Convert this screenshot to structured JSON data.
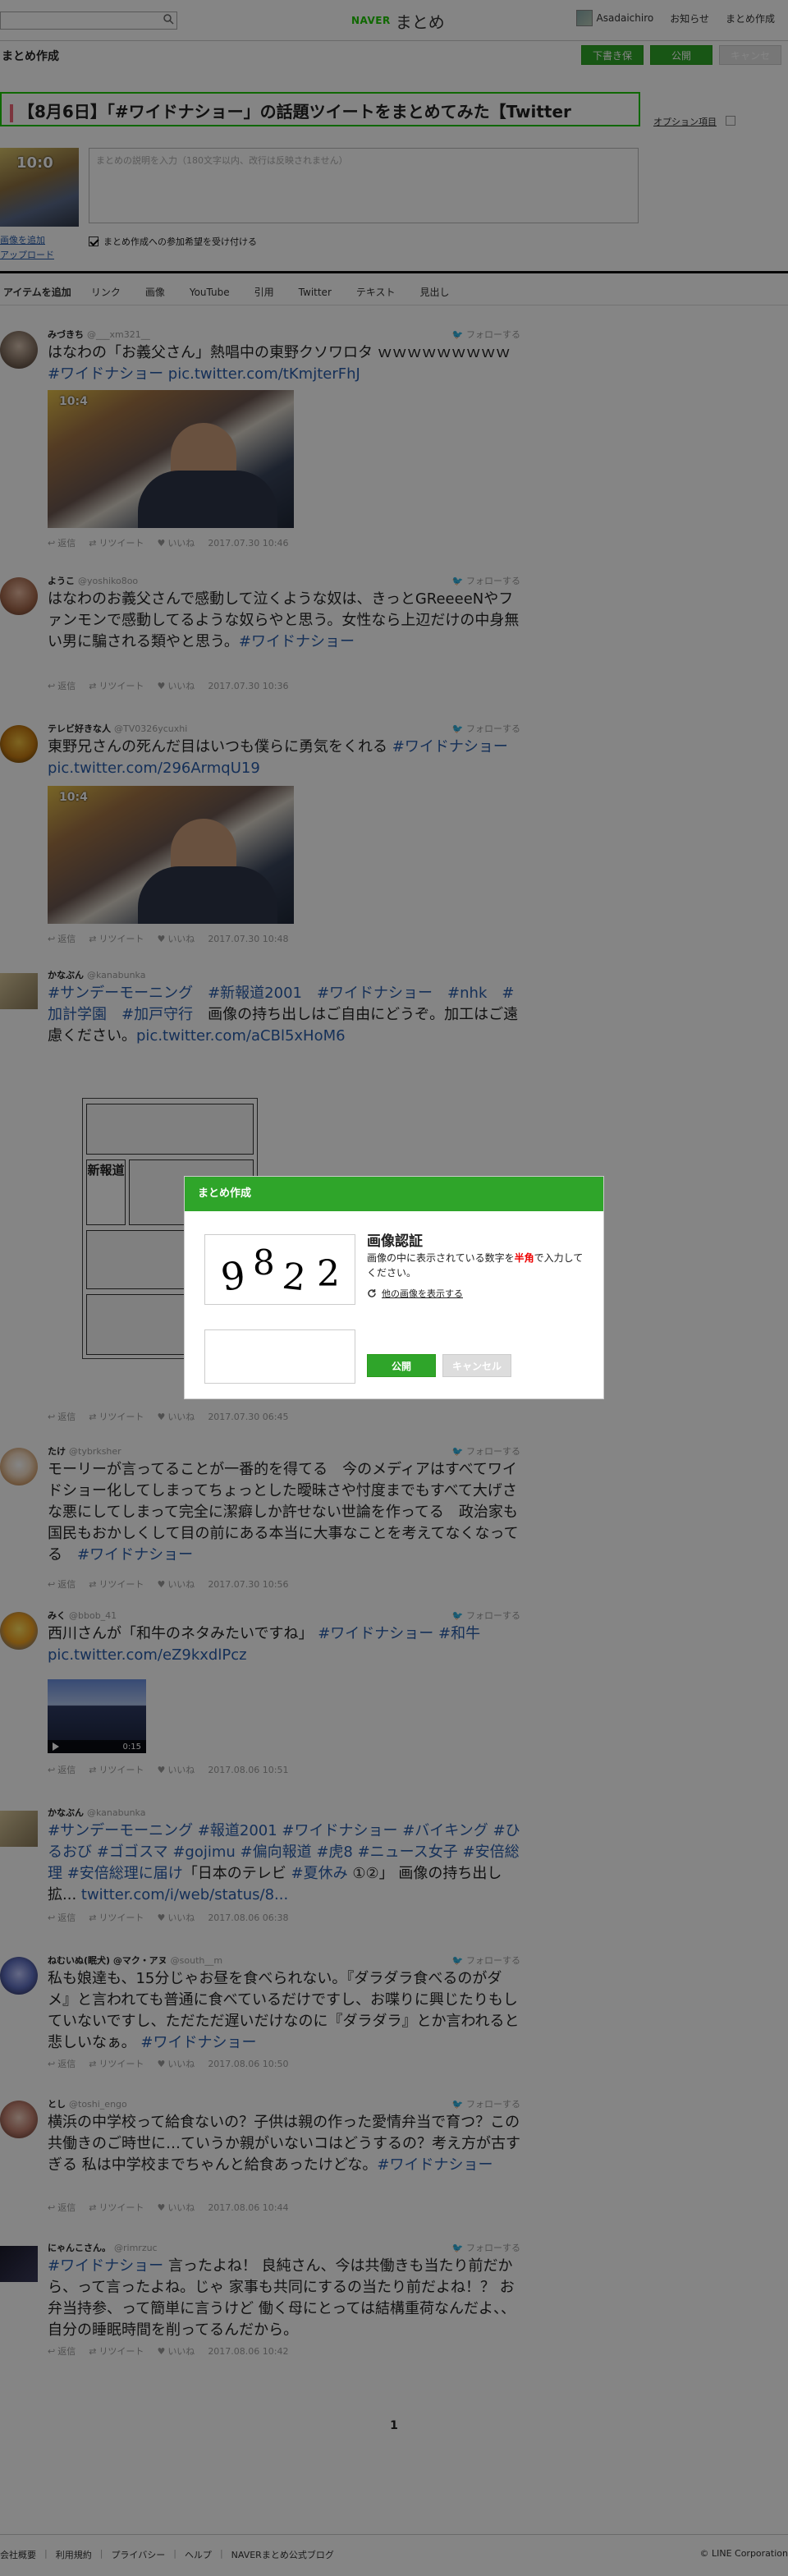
{
  "header": {
    "logo_brand": "NAVER",
    "logo_text": "まとめ",
    "user_name": "Asadaichiro",
    "nav_notifications": "お知らせ",
    "nav_create": "まとめ作成"
  },
  "editor": {
    "section_title": "まとめ作成",
    "btn_draft": "下書き保存",
    "btn_publish": "公開",
    "btn_cancel": "キャンセル",
    "title_value": "【8月6日】「#ワイドナショー」の話題ツイートをまとめてみた【Twitter",
    "option_label": "オプション項目",
    "description_placeholder": "まとめの説明を入力（180文字以内、改行は反映されません）",
    "thumb_link_change": "画像を追加",
    "thumb_link_upload": "アップロード",
    "collab_label": "まとめ作成への参加希望を受け付ける"
  },
  "tabs": {
    "add_label": "アイテムを追加",
    "items": [
      "リンク",
      "画像",
      "YouTube",
      "引用",
      "Twitter",
      "テキスト",
      "見出し"
    ]
  },
  "tweet_actions": {
    "reply": "返信",
    "retweet": "リツイート",
    "like": "いいね",
    "follow": "フォローする"
  },
  "tweets": [
    {
      "name": "みづきち",
      "handle": "@___xm321__",
      "text": "はなわの「お義父さん」熱唱中の東野クソワロタ ｗｗｗｗｗｗｗｗｗ ",
      "link": "#ワイドナショー pic.twitter.com/tKmjterFhJ",
      "date": "2017.07.30 10:46"
    },
    {
      "name": "ようこ",
      "handle": "@yoshiko8oo",
      "text": "はなわのお義父さんで感動して泣くような奴は、きっとGReeeeNやファンモンで感動してるような奴らやと思う。女性なら上辺だけの中身無い男に騙される類やと思う。",
      "link": "#ワイドナショー",
      "date": "2017.07.30 10:36"
    },
    {
      "name": "テレビ好きな人",
      "handle": "@TV0326ycuxhi",
      "text": "東野兄さんの死んだ目はいつも僕らに勇気をくれる ",
      "link": "#ワイドナショー pic.twitter.com/296ArmqU19",
      "date": "2017.07.30 10:48"
    },
    {
      "name": "かなぶん",
      "handle": "@kanabunka",
      "link": "#サンデーモーニング　#新報道2001　#ワイドナショー　#nhk　#加計学園　#加戸守行",
      "text": "　画像の持ち出しはご自由にどうぞ。加工はご遠慮ください。",
      "link2": "pic.twitter.com/aCBl5xHoM6",
      "date": "2017.07.30 06:45"
    },
    {
      "name": "たけ",
      "handle": "@tybrksher",
      "text": "モーリーが言ってることが一番的を得てる　今のメディアはすべてワイドショー化してしまってちょっとした曖昧さや忖度までもすべて大げさな悪にしてしまって完全に潔癖しか許せない世論を作ってる　政治家も国民もおかしくして目の前にある本当に大事なことを考えてなくなってる　",
      "link": "#ワイドナショー",
      "date": "2017.07.30 10:56"
    },
    {
      "name": "みく",
      "handle": "@bbob_41",
      "text": "西川さんが「和牛のネタみたいですね」 ",
      "link": "#ワイドナショー #和牛 pic.twitter.com/eZ9kxdlPcz",
      "video_time": "0:15",
      "date": "2017.08.06 10:51"
    },
    {
      "name": "かなぶん",
      "handle": "@kanabunka",
      "link": "#サンデーモーニング #報道2001 #ワイドナショー #バイキング #ひるおび #ゴゴスマ #gojimu #偏向報道 #虎8 #ニュース女子 #安倍総理 #安倍総理に届け",
      "text": "「日本のテレビ ",
      "link2": "#夏休み",
      "text2": " ①②」 画像の持ち出し拡... ",
      "link3": "twitter.com/i/web/status/8...",
      "date": "2017.08.06 06:38"
    },
    {
      "name": "ねむいぬ(眠犬) @マク・アヌ",
      "handle": "@south__m",
      "text": "私も娘達も、15分じゃお昼を食べられない。『ダラダラ食べるのがダメ』と言われても普通に食べているだけですし、お喋りに興じたりもしていないですし、ただただ遅いだけなのに『ダラダラ』とか言われると悲しいなぁ。 ",
      "link": "#ワイドナショー",
      "date": "2017.08.06 10:50"
    },
    {
      "name": "とし",
      "handle": "@toshi_engo",
      "text": "横浜の中学校って給食ないの？子供は親の作った愛情弁当で育つ？この共働きのご時世に…ていうか親がいないコはどうするの？考え方が古すぎる 私は中学校までちゃんと給食あったけどな。",
      "link": "#ワイドナショー",
      "date": "2017.08.06 10:44"
    },
    {
      "name": "にゃんこさん。",
      "handle": "@rimrzuc",
      "link": "#ワイドナショー",
      "text": " 言ったよね！ 良純さん、今は共働きも当たり前だから、って言ったよね。じゃ 家事も共同にするの当たり前だよね！？ お弁当持参、って簡単に言うけど 働く母にとっては結構重荷なんだよ、、 自分の睡眠時間を削ってるんだから。",
      "date": "2017.08.06 10:42"
    }
  ],
  "pager": {
    "current": "1"
  },
  "footer": {
    "links": [
      "会社概要",
      "利用規約",
      "プライバシー",
      "ヘルプ",
      "NAVERまとめ公式ブログ"
    ],
    "corp": "© LINE Corporation"
  },
  "modal": {
    "header": "まとめ作成",
    "title": "画像認証",
    "desc_1": "画像の中に表示されている数字を",
    "desc_red": "半角",
    "desc_2": "で入力してください。",
    "link_other": "他の画像を表示する",
    "captcha_digits": [
      "9",
      "8",
      "2",
      "2"
    ],
    "btn_publish": "公開",
    "btn_cancel": "キャンセル"
  }
}
